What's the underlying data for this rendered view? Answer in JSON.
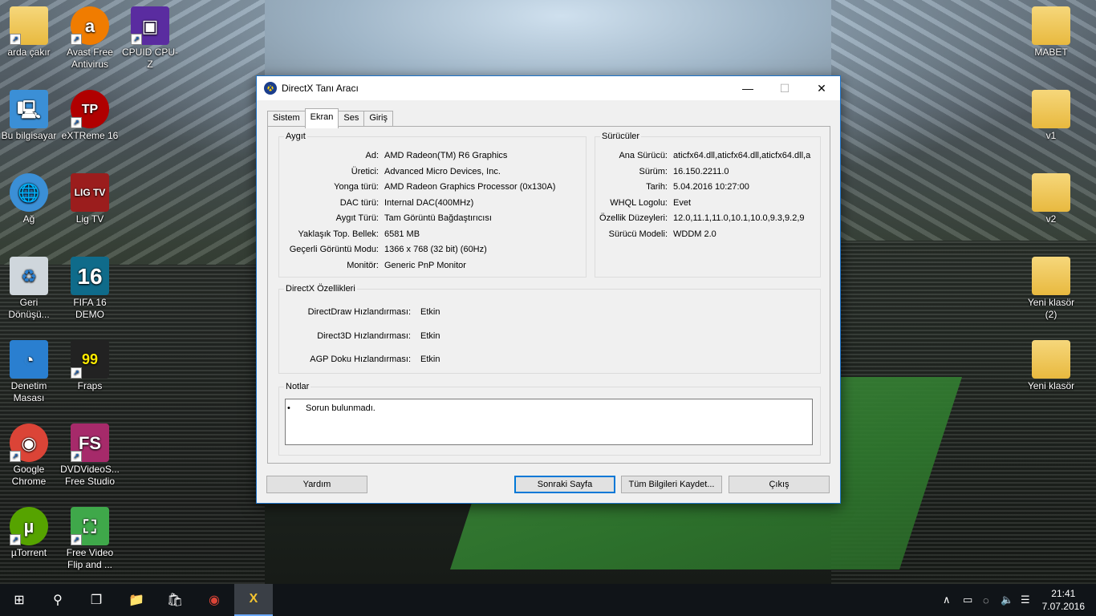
{
  "desktop": {
    "left_icons": [
      {
        "label": "arda çakır",
        "icon": "user-folder-icon",
        "color": "#e8b93f"
      },
      {
        "label": "Avast Free Antivirus",
        "icon": "avast-icon",
        "color": "#f07c00"
      },
      {
        "label": "CPUID CPU-Z",
        "icon": "cpuz-icon",
        "color": "#5a2ca0"
      },
      {
        "label": "Bu bilgisayar",
        "icon": "computer-icon",
        "color": "#3b8fd6"
      },
      {
        "label": "eXTReme 16",
        "icon": "extreme-icon",
        "color": "#b00000"
      },
      {
        "label": "Ağ",
        "icon": "network-icon",
        "color": "#3b8fd6"
      },
      {
        "label": "Lig TV",
        "icon": "ligtv-icon",
        "color": "#9b1d1d"
      },
      {
        "label": "Geri Dönüşü...",
        "icon": "recycle-bin-icon",
        "color": "#cfd6dc"
      },
      {
        "label": "FIFA 16 DEMO",
        "icon": "fifa-icon",
        "color": "#0f6b8a"
      },
      {
        "label": "Denetim Masası",
        "icon": "control-panel-icon",
        "color": "#2a7fd0"
      },
      {
        "label": "Fraps",
        "icon": "fraps-icon",
        "color": "#222222"
      },
      {
        "label": "Google Chrome",
        "icon": "chrome-icon",
        "color": "#db4437"
      },
      {
        "label": "DVDVideoS... Free Studio",
        "icon": "dvdvideosoft-icon",
        "color": "#a62a6a"
      },
      {
        "label": "µTorrent",
        "icon": "utorrent-icon",
        "color": "#56a300"
      },
      {
        "label": "Free Video Flip and ...",
        "icon": "free-video-flip-icon",
        "color": "#3fa84a"
      }
    ],
    "right_icons": [
      {
        "label": "MABET",
        "icon": "folder-icon"
      },
      {
        "label": "v1",
        "icon": "folder-icon"
      },
      {
        "label": "v2",
        "icon": "folder-icon"
      },
      {
        "label": "Yeni klasör (2)",
        "icon": "folder-icon"
      },
      {
        "label": "Yeni klasör",
        "icon": "folder-icon"
      }
    ],
    "glyphs": {
      "avast": "a",
      "cpuz": "▣",
      "extreme": "TP",
      "ligtv": "LIG TV",
      "fifa": "16",
      "fraps": "99",
      "dvd": "FS",
      "utorrent": "µ",
      "flip": "⛶",
      "chrome": "◉",
      "recycle": "♻",
      "computer": "🖳",
      "network": "🌐",
      "control": "◔",
      "shortcut": "↗"
    }
  },
  "window": {
    "title": "DirectX Tanı Aracı",
    "app_icon": "X",
    "controls": {
      "minimize": "—",
      "maximize": "☐",
      "close": "✕"
    },
    "tabs": [
      "Sistem",
      "Ekran",
      "Ses",
      "Giriş"
    ],
    "active_tab": "Ekran",
    "device": {
      "legend": "Aygıt",
      "rows": [
        {
          "label": "Ad:",
          "value": "AMD Radeon(TM) R6 Graphics"
        },
        {
          "label": "Üretici:",
          "value": "Advanced Micro Devices, Inc."
        },
        {
          "label": "Yonga türü:",
          "value": "AMD Radeon Graphics Processor (0x130A)"
        },
        {
          "label": "DAC türü:",
          "value": "Internal DAC(400MHz)"
        },
        {
          "label": "Aygıt Türü:",
          "value": "Tam Görüntü Bağdaştırıcısı"
        },
        {
          "label": "Yaklaşık Top. Bellek:",
          "value": "6581 MB"
        },
        {
          "label": "Geçerli Görüntü Modu:",
          "value": "1366 x 768 (32 bit) (60Hz)"
        },
        {
          "label": "Monitör:",
          "value": "Generic PnP Monitor"
        }
      ]
    },
    "drivers": {
      "legend": "Sürücüler",
      "rows": [
        {
          "label": "Ana Sürücü:",
          "value": "aticfx64.dll,aticfx64.dll,aticfx64.dll,a"
        },
        {
          "label": "Sürüm:",
          "value": "16.150.2211.0"
        },
        {
          "label": "Tarih:",
          "value": "5.04.2016 10:27:00"
        },
        {
          "label": "WHQL Logolu:",
          "value": "Evet"
        },
        {
          "label": "Özellik Düzeyleri:",
          "value": "12.0,11.1,11.0,10.1,10.0,9.3,9.2,9"
        },
        {
          "label": "Sürücü Modeli:",
          "value": "WDDM 2.0"
        }
      ]
    },
    "features": {
      "legend": "DirectX Özellikleri",
      "rows": [
        {
          "label": "DirectDraw Hızlandırması:",
          "value": "Etkin"
        },
        {
          "label": "Direct3D Hızlandırması:",
          "value": "Etkin"
        },
        {
          "label": "AGP Doku Hızlandırması:",
          "value": "Etkin"
        }
      ]
    },
    "notes": {
      "legend": "Notlar",
      "bullet": "•",
      "items": [
        "Sorun bulunmadı."
      ]
    },
    "buttons": {
      "help": "Yardım",
      "next_page": "Sonraki Sayfa",
      "save_all": "Tüm Bilgileri Kaydet...",
      "exit": "Çıkış"
    }
  },
  "taskbar": {
    "icons": {
      "start": "⊞",
      "search": "⚲",
      "task_view": "❐",
      "explorer": "📁",
      "store": "🛍",
      "chrome": "◉",
      "dxdiag": "X"
    },
    "tray": {
      "chevron": "∧",
      "battery": "▭",
      "network": "◌",
      "volume": "🔈",
      "notifications": "☰"
    },
    "time": "21:41",
    "date": "7.07.2016"
  }
}
